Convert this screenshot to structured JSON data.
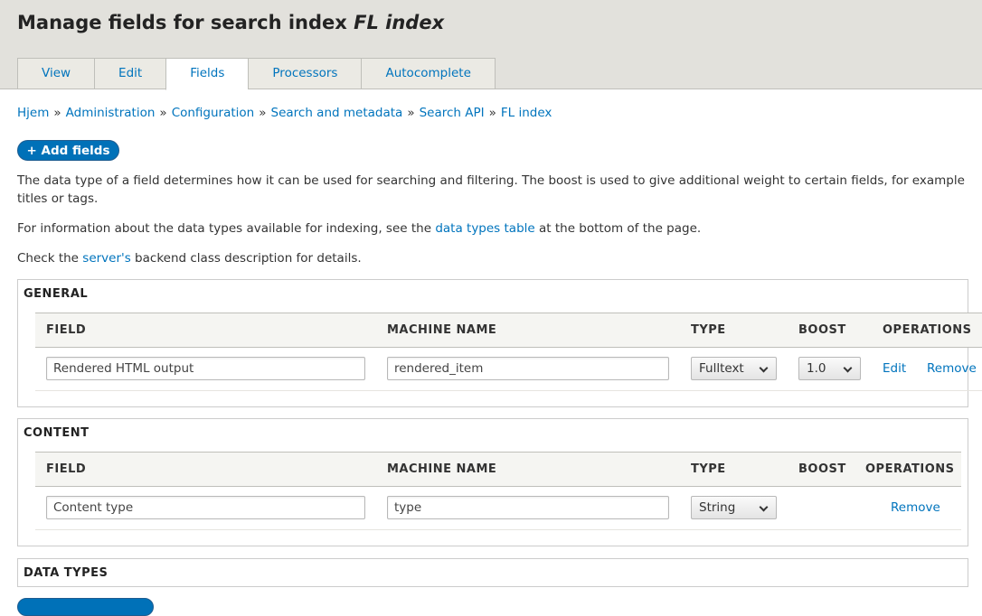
{
  "header": {
    "title_prefix": "Manage fields for search index ",
    "title_index": "FL index",
    "tabs": [
      {
        "label": "View",
        "active": false
      },
      {
        "label": "Edit",
        "active": false
      },
      {
        "label": "Fields",
        "active": true
      },
      {
        "label": "Processors",
        "active": false
      },
      {
        "label": "Autocomplete",
        "active": false
      }
    ]
  },
  "breadcrumb": [
    "Hjem",
    "Administration",
    "Configuration",
    "Search and metadata",
    "Search API",
    "FL index"
  ],
  "breadcrumb_separator": "»",
  "add_fields_label": "+ Add fields",
  "description": {
    "line1": "The data type of a field determines how it can be used for searching and filtering. The boost is used to give additional weight to certain fields, for example titles or tags.",
    "line2_before": "For information about the data types available for indexing, see the ",
    "line2_link": "data types table",
    "line2_after": " at the bottom of the page.",
    "line3_before": "Check the ",
    "line3_link": "server's",
    "line3_after": " backend class description for details."
  },
  "columns": {
    "field": "FIELD",
    "machine_name": "MACHINE NAME",
    "type": "TYPE",
    "boost": "BOOST",
    "operations": "OPERATIONS"
  },
  "general": {
    "legend": "GENERAL",
    "rows": [
      {
        "field": "Rendered HTML output",
        "machine_name": "rendered_item",
        "type": "Fulltext",
        "boost": "1.0",
        "edit": "Edit",
        "remove": "Remove"
      }
    ]
  },
  "content": {
    "legend": "CONTENT",
    "rows": [
      {
        "field": "Content type",
        "machine_name": "type",
        "type": "String",
        "remove": "Remove"
      }
    ]
  },
  "data_types": {
    "legend": "DATA TYPES"
  },
  "colors": {
    "link": "#0074bd",
    "primary_button": "#0071b8",
    "header_bg": "#e2e1dc"
  }
}
